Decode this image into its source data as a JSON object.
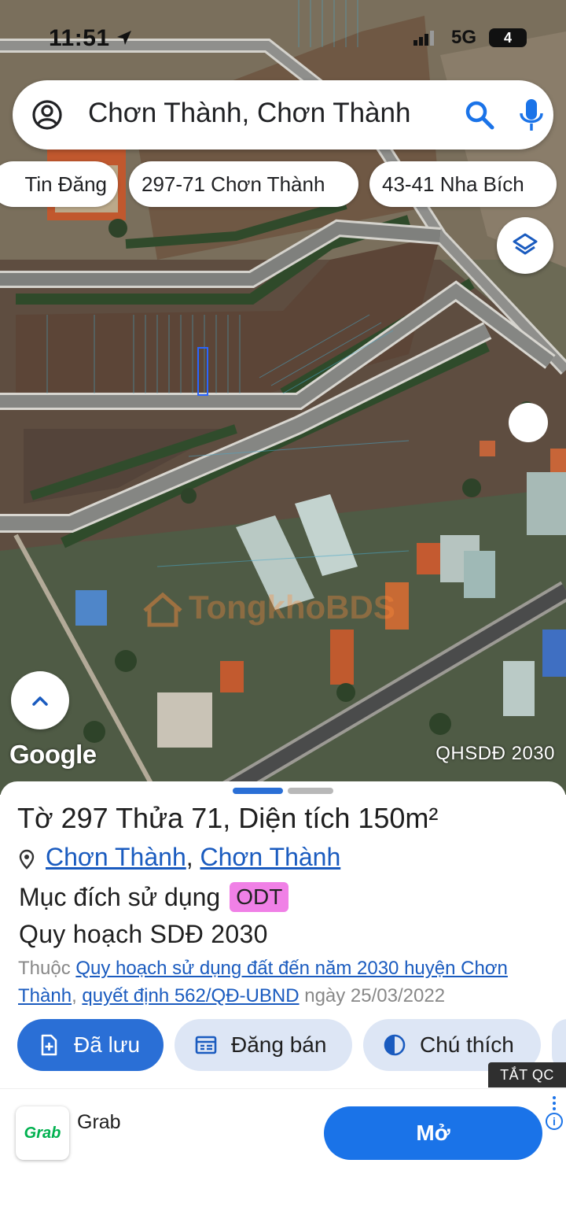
{
  "status_bar": {
    "time": "11:51",
    "network": "5G",
    "battery": "4"
  },
  "search": {
    "query": "Chơn Thành, Chơn Thành"
  },
  "chips": [
    {
      "label": "Tin Đăng"
    },
    {
      "label": "297-71 Chơn Thành"
    },
    {
      "label": "43-41 Nha Bích"
    }
  ],
  "map": {
    "logo": "Google",
    "plan_label": "QHSDĐ 2030",
    "watermark": "TongkhoBDS"
  },
  "parcel": {
    "title_prefix": "Tờ",
    "sheet_no": "297",
    "plot_word": "Thửa",
    "plot_no": "71",
    "area_word": ", Diện tích",
    "area_value": "150m²",
    "location_1": "Chơn Thành",
    "location_sep": ",",
    "location_2": "Chơn Thành",
    "purpose_label": "Mục đích sử dụng",
    "purpose_code": "ODT",
    "plan_name": "Quy hoạch SDĐ 2030",
    "belongs_label": "Thuộc",
    "plan_link_1": "Quy hoạch sử dụng đất đến năm 2030 huyện Chơn Thành",
    "plan_sep": ",",
    "decision_link": "quyết định 562/QĐ-UBND",
    "date_label": "ngày 25/03/2022"
  },
  "actions": {
    "saved": "Đã lưu",
    "sell": "Đăng bán",
    "legend": "Chú thích"
  },
  "ad": {
    "close_label": "TẮT QC",
    "logo_text": "Grab",
    "app_name": "Grab",
    "open_label": "Mở"
  },
  "colors": {
    "accent": "#2a6fd6",
    "badge": "#f080e6",
    "link": "#1a5bbf",
    "ad_button": "#1a73e8"
  }
}
